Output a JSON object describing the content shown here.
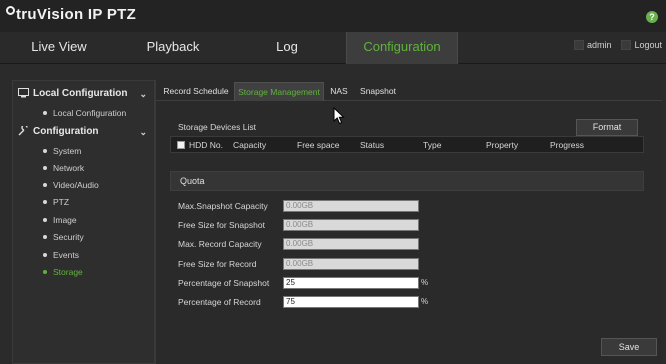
{
  "header": {
    "logo_prefix": "tru",
    "logo_suffix": "Vision  IP PTZ",
    "help_label": "?"
  },
  "nav": {
    "tabs": [
      {
        "label": "Live View"
      },
      {
        "label": "Playback"
      },
      {
        "label": "Log"
      },
      {
        "label": "Configuration"
      }
    ],
    "active_tab": "Configuration",
    "user": "admin",
    "logout": "Logout"
  },
  "sidebar": {
    "local_header": "Local Configuration",
    "local_items": [
      "Local Configuration"
    ],
    "config_header": "Configuration",
    "config_items": [
      "System",
      "Network",
      "Video/Audio",
      "PTZ",
      "Image",
      "Security",
      "Events",
      "Storage"
    ],
    "active_item": "Storage"
  },
  "subtabs": {
    "items": [
      "Record Schedule",
      "Storage Management",
      "NAS",
      "Snapshot"
    ],
    "active": "Storage Management"
  },
  "storage": {
    "title": "Storage Devices List",
    "format_label": "Format",
    "columns": [
      "HDD No.",
      "Capacity",
      "Free space",
      "Status",
      "Type",
      "Property",
      "Progress"
    ]
  },
  "quota": {
    "title": "Quota",
    "rows": [
      {
        "label": "Max.Snapshot Capacity",
        "value": "0.00GB",
        "editable": false,
        "unit": ""
      },
      {
        "label": "Free Size for Snapshot",
        "value": "0.00GB",
        "editable": false,
        "unit": ""
      },
      {
        "label": "Max. Record Capacity",
        "value": "0.00GB",
        "editable": false,
        "unit": ""
      },
      {
        "label": "Free Size for Record",
        "value": "0.00GB",
        "editable": false,
        "unit": ""
      },
      {
        "label": "Percentage of Snapshot",
        "value": "25",
        "editable": true,
        "unit": "%"
      },
      {
        "label": "Percentage of Record",
        "value": "75",
        "editable": true,
        "unit": "%"
      }
    ]
  },
  "footer": {
    "save_label": "Save"
  },
  "colors": {
    "accent": "#5fb33b",
    "background": "#2b2b2b",
    "header": "#232323"
  }
}
